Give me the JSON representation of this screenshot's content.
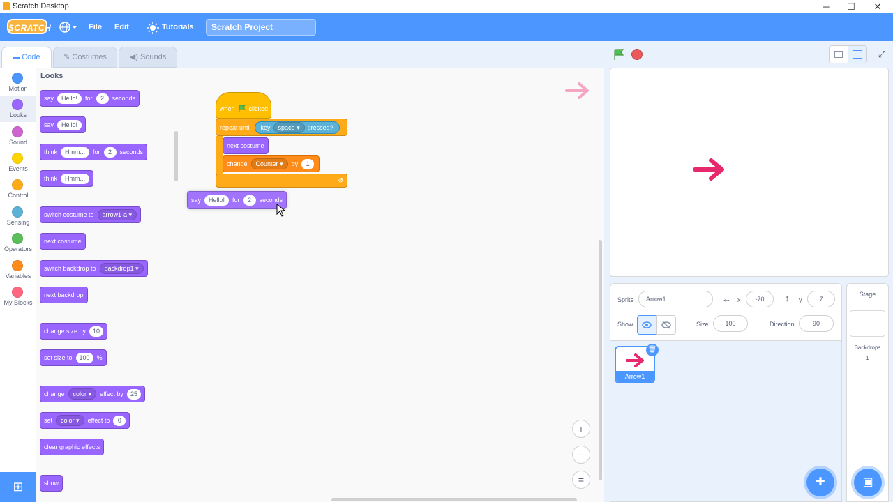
{
  "window": {
    "title": "Scratch Desktop",
    "minimize": "─",
    "maximize": "☐",
    "close": "✕"
  },
  "menubar": {
    "logo": "SCRATCH",
    "file": "File",
    "edit": "Edit",
    "tutorials": "Tutorials",
    "project_title": "Scratch Project"
  },
  "tabs": {
    "code": "Code",
    "costumes": "Costumes",
    "sounds": "Sounds"
  },
  "categories": [
    {
      "label": "Motion",
      "color": "#4c97ff"
    },
    {
      "label": "Looks",
      "color": "#9966ff"
    },
    {
      "label": "Sound",
      "color": "#cf63cf"
    },
    {
      "label": "Events",
      "color": "#ffd500"
    },
    {
      "label": "Control",
      "color": "#ffab19"
    },
    {
      "label": "Sensing",
      "color": "#5cb1d6"
    },
    {
      "label": "Operators",
      "color": "#59c059"
    },
    {
      "label": "Variables",
      "color": "#ff8c1a"
    },
    {
      "label": "My Blocks",
      "color": "#ff6680"
    }
  ],
  "palette": {
    "heading": "Looks",
    "say_for": {
      "say": "say",
      "msg": "Hello!",
      "for": "for",
      "secs": "2",
      "seconds": "seconds"
    },
    "say": {
      "say": "say",
      "msg": "Hello!"
    },
    "think_for": {
      "think": "think",
      "msg": "Hmm...",
      "for": "for",
      "secs": "2",
      "seconds": "seconds"
    },
    "think": {
      "think": "think",
      "msg": "Hmm..."
    },
    "switch_costume": {
      "label": "switch costume to",
      "value": "arrow1-a"
    },
    "next_costume": "next costume",
    "switch_backdrop": {
      "label": "switch backdrop to",
      "value": "backdrop1"
    },
    "next_backdrop": "next backdrop",
    "change_size": {
      "label": "change size by",
      "value": "10"
    },
    "set_size": {
      "label": "set size to",
      "value": "100",
      "unit": "%"
    },
    "change_effect": {
      "change": "change",
      "effect": "color",
      "by": "effect by",
      "value": "25"
    },
    "set_effect": {
      "set": "set",
      "effect": "color",
      "to": "effect to",
      "value": "0"
    },
    "clear_effects": "clear graphic effects",
    "show": "show"
  },
  "script": {
    "hat": {
      "when": "when",
      "clicked": "clicked"
    },
    "repeat_until": {
      "label": "repeat until",
      "key": "key",
      "key_value": "space",
      "pressed": "pressed?"
    },
    "next_costume": "next costume",
    "change_var": {
      "change": "change",
      "var": "Counter",
      "by": "by",
      "value": "1"
    },
    "loop_arrow": "↺",
    "dragged_say": {
      "say": "say",
      "msg": "Hello!",
      "for": "for",
      "secs": "2",
      "seconds": "seconds"
    }
  },
  "zoom": {
    "in": "+",
    "out": "−",
    "reset": "="
  },
  "sprite_info": {
    "sprite_label": "Sprite",
    "sprite_name": "Arrow1",
    "x_label": "x",
    "x": "-70",
    "y_label": "y",
    "y": "7",
    "show_label": "Show",
    "size_label": "Size",
    "size": "100",
    "direction_label": "Direction",
    "direction": "90"
  },
  "sprites": [
    {
      "name": "Arrow1"
    }
  ],
  "stage_pane": {
    "title": "Stage",
    "backdrops_label": "Backdrops",
    "backdrops_count": "1"
  },
  "colors": {
    "accent": "#4c97ff",
    "arrow": "#e6296c"
  }
}
